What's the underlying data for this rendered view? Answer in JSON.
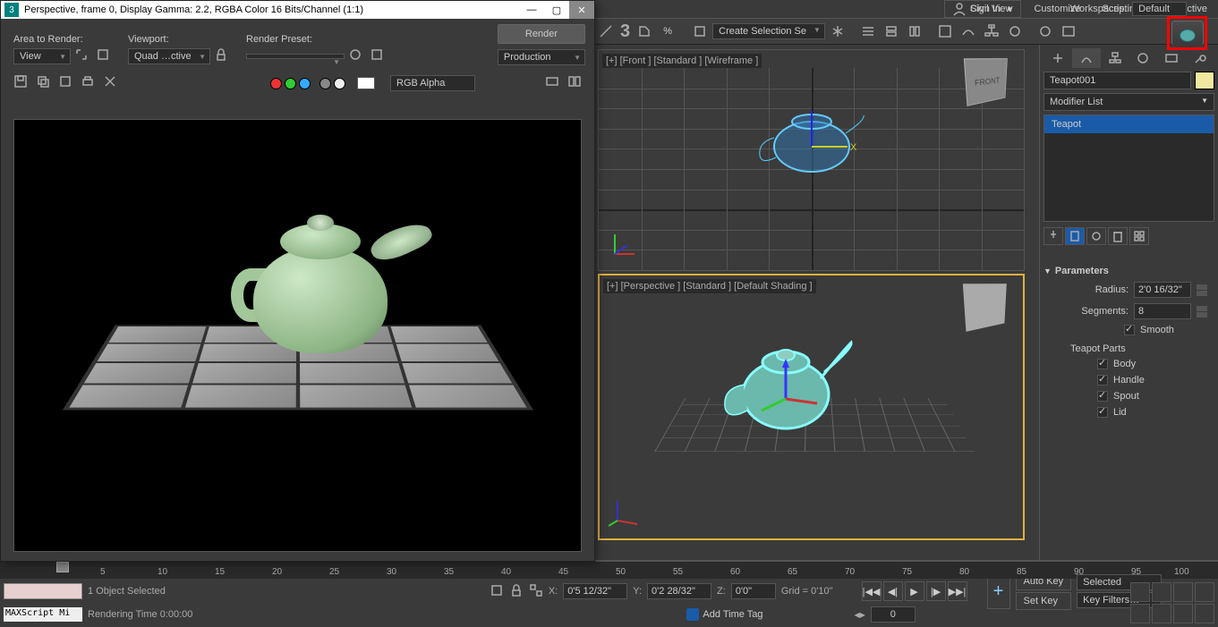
{
  "menubar": {
    "items": [
      "Civil View",
      "Customize",
      "Scripting",
      "Interactive"
    ]
  },
  "signin": {
    "label": "Sign In"
  },
  "workspaces": {
    "label": "Workspaces:",
    "value": "Default"
  },
  "main_toolbar": {
    "selection_set": "Create Selection Se"
  },
  "render_window": {
    "title": "Perspective, frame 0, Display Gamma: 2.2, RGBA Color 16 Bits/Channel (1:1)",
    "area_to_render_lbl": "Area to Render:",
    "area_to_render": "View",
    "viewport_lbl": "Viewport:",
    "viewport": "Quad …ctive",
    "preset_lbl": "Render Preset:",
    "preset": "",
    "render_btn": "Render",
    "production": "Production",
    "alpha_channel": "RGB Alpha"
  },
  "viewports": {
    "front": "[+] [Front ] [Standard ] [Wireframe ]",
    "persp": "[+] [Perspective ] [Standard ] [Default Shading ]",
    "cube_front": "FRONT"
  },
  "panel": {
    "object_name": "Teapot001",
    "modifier_list": "Modifier List",
    "stack_item": "Teapot",
    "params_header": "Parameters",
    "radius_lbl": "Radius:",
    "radius": "2'0 16/32\"",
    "segments_lbl": "Segments:",
    "segments": "8",
    "smooth": "Smooth",
    "parts_lbl": "Teapot Parts",
    "body": "Body",
    "handle": "Handle",
    "spout": "Spout",
    "lid": "Lid"
  },
  "time_ticks": [
    5,
    10,
    15,
    20,
    25,
    30,
    35,
    40,
    45,
    50,
    55,
    60,
    65,
    70,
    75,
    80,
    85,
    90,
    95,
    100
  ],
  "status": {
    "selection": "1 Object Selected",
    "maxscript": "MAXScript Mi",
    "rendering_time": "Rendering Time  0:00:00",
    "x": "0'5 12/32\"",
    "y": "0'2 28/32\"",
    "z": "0'0\"",
    "grid": "Grid = 0'10\"",
    "frame": "0",
    "auto_key": "Auto Key",
    "set_key": "Set Key",
    "selected": "Selected",
    "key_filters": "Key Filters…",
    "add_time_tag": "Add Time Tag"
  }
}
